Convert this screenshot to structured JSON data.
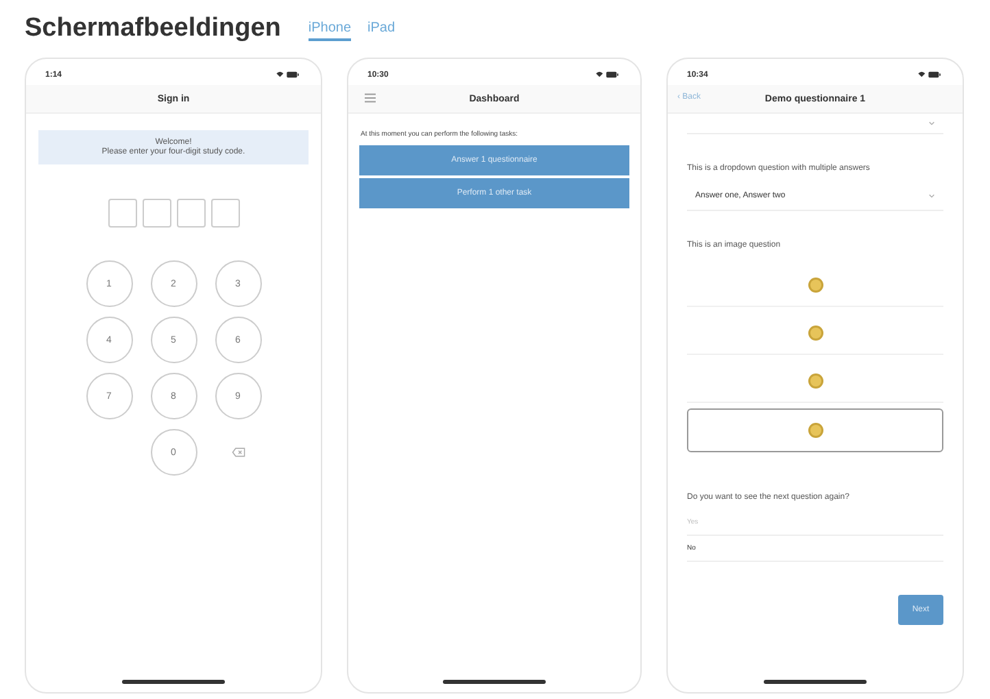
{
  "heading": "Schermafbeeldingen",
  "tabs": [
    {
      "label": "iPhone",
      "selected": true
    },
    {
      "label": "iPad",
      "selected": false
    }
  ],
  "phones": [
    {
      "kind": "signin",
      "time": "1:14",
      "title": "Sign in",
      "welcome": "Welcome!",
      "prompt": "Please enter your four-digit study code.",
      "keys": [
        {
          "kind": "digit",
          "label": "1"
        },
        {
          "kind": "digit",
          "label": "2"
        },
        {
          "kind": "digit",
          "label": "3"
        },
        {
          "kind": "digit",
          "label": "4"
        },
        {
          "kind": "digit",
          "label": "5"
        },
        {
          "kind": "digit",
          "label": "6"
        },
        {
          "kind": "digit",
          "label": "7"
        },
        {
          "kind": "digit",
          "label": "8"
        },
        {
          "kind": "digit",
          "label": "9"
        },
        {
          "kind": "gap"
        },
        {
          "kind": "digit",
          "label": "0"
        },
        {
          "kind": "delete"
        }
      ]
    },
    {
      "kind": "dashboard",
      "time": "10:30",
      "title": "Dashboard",
      "intro": "At this moment you can perform the following tasks:",
      "buttons": [
        "Answer 1 questionnaire",
        "Perform 1 other task"
      ]
    },
    {
      "kind": "questionnaire",
      "time": "10:34",
      "back": "‹ Back",
      "title": "Demo questionnaire 1",
      "dropdown_question": "This is a dropdown question with multiple answers",
      "dropdown_value": "Answer one, Answer two",
      "image_question": "This is an image question",
      "image_options": [
        {
          "selected": false
        },
        {
          "selected": false
        },
        {
          "selected": false
        },
        {
          "selected": true
        }
      ],
      "repeat_question": "Do you want to see the next question again?",
      "answers": [
        {
          "label": "Yes",
          "disabled": true
        },
        {
          "label": "No",
          "disabled": false
        }
      ],
      "next": "Next"
    }
  ]
}
